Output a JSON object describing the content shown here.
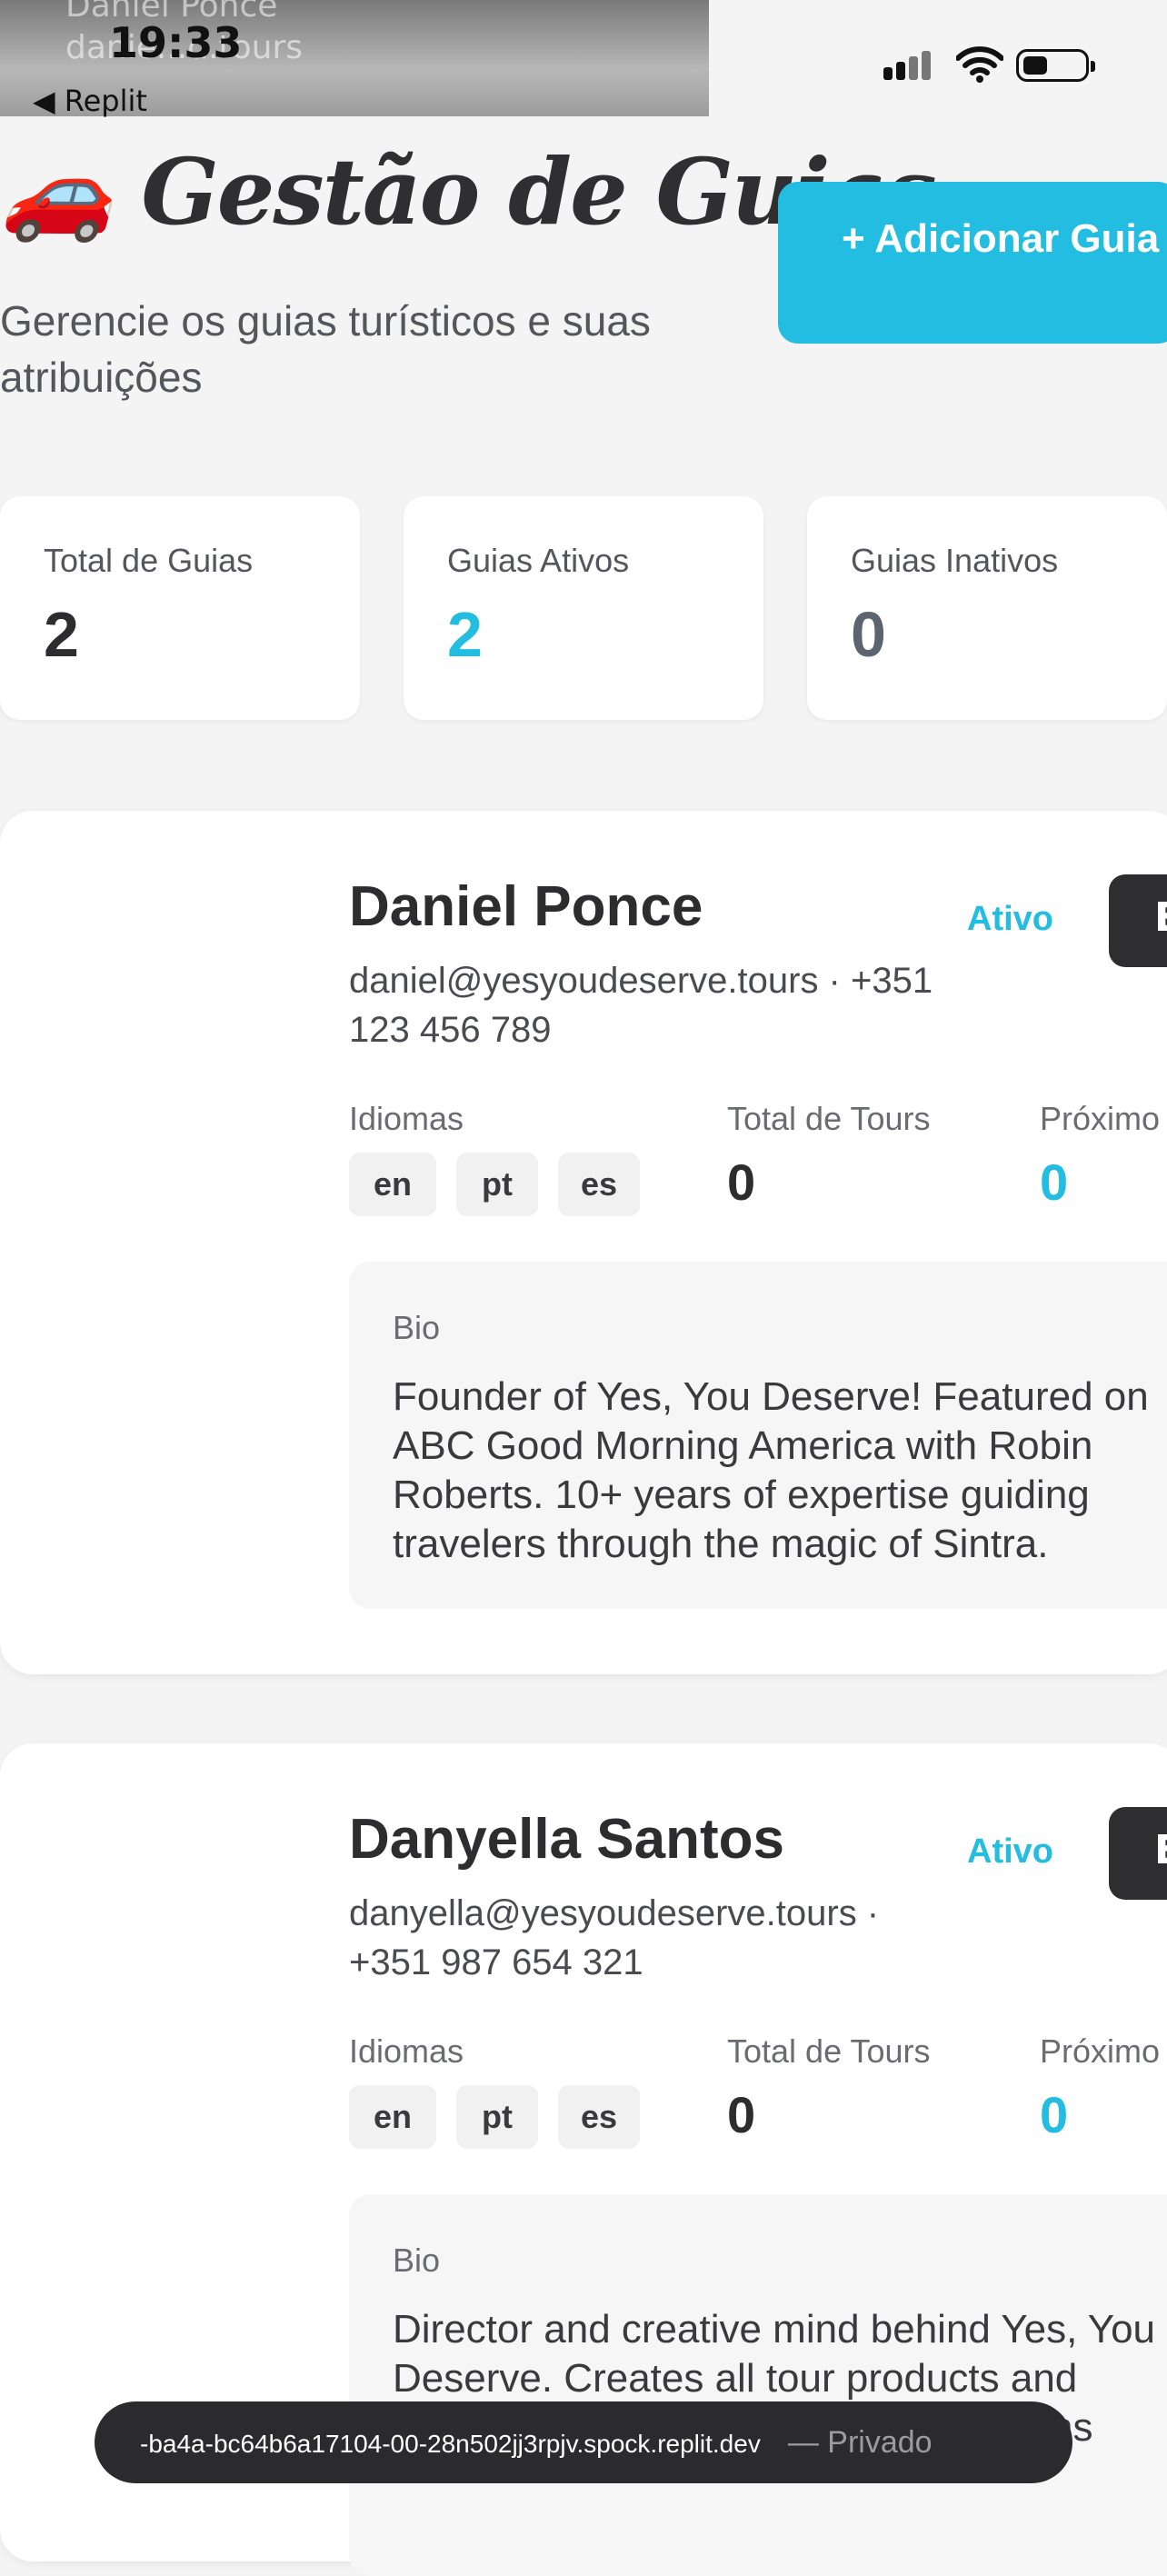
{
  "status": {
    "time": "19:33",
    "back_label": "◀ Replit",
    "ghost_name": "Daniel Ponce",
    "ghost_url": "danie...d.tours"
  },
  "header": {
    "title": "🚗 Gestão de Guias",
    "subtitle": "Gerencie os guias turísticos e suas atribuições",
    "add_button": "+ Adicionar Guia"
  },
  "stats": [
    {
      "label": "Total de Guias",
      "value": "2",
      "color": "#2d2d2f"
    },
    {
      "label": "Guias Ativos",
      "value": "2",
      "color": "#22bde0"
    },
    {
      "label": "Guias Inativos",
      "value": "0",
      "color": "#5c6470"
    }
  ],
  "guides": [
    {
      "name": "Daniel Ponce",
      "status": "Ativo",
      "edit_label": "E",
      "contact": "daniel@yesyoudeserve.tours · +351 123 456 789",
      "languages_label": "Idiomas",
      "languages": [
        "en",
        "pt",
        "es"
      ],
      "tours_label": "Total de Tours",
      "tours_value": "0",
      "next_label": "Próximo",
      "next_value": "0",
      "bio_label": "Bio",
      "bio": "Founder of Yes, You Deserve! Featured on ABC Good Morning America with Robin Roberts. 10+ years of expertise guiding travelers through the magic of Sintra."
    },
    {
      "name": "Danyella Santos",
      "status": "Ativo",
      "edit_label": "E",
      "contact": "danyella@yesyoudeserve.tours · +351 987 654 321",
      "languages_label": "Idiomas",
      "languages": [
        "en",
        "pt",
        "es"
      ],
      "tours_label": "Total de Tours",
      "tours_value": "0",
      "next_label": "Próximo",
      "next_value": "0",
      "bio_label": "Bio",
      "bio": "Director and creative mind behind Yes, You Deserve. Creates all tour products and exceptional guest experience intentions"
    }
  ],
  "urlbar": {
    "url": "-ba4a-bc64b6a17104-00-28n502jj3rpjv.spock.replit.dev",
    "privacy": "— Privado"
  },
  "colors": {
    "accent": "#22bde0",
    "dark": "#2e2e30"
  }
}
